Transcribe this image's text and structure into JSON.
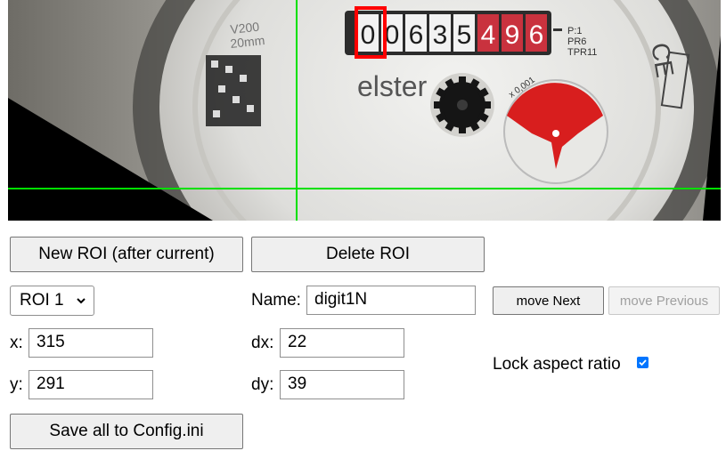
{
  "buttons": {
    "new_roi": "New ROI (after current)",
    "delete_roi": "Delete ROI",
    "move_next": "move Next",
    "move_previous": "move Previous",
    "save_all": "Save all to Config.ini"
  },
  "roi_select": {
    "selected": "ROI 1"
  },
  "fields": {
    "name_label": "Name:",
    "name_value": "digit1N",
    "x_label": "x:",
    "x_value": "315",
    "y_label": "y:",
    "y_value": "291",
    "dx_label": "dx:",
    "dx_value": "22",
    "dy_label": "dy:",
    "dy_value": "39"
  },
  "lock_aspect": {
    "label": "Lock aspect ratio",
    "checked": true
  },
  "meter_image": {
    "counter_digits": [
      "0",
      "0",
      "6",
      "3",
      "5",
      "4",
      "9",
      "6"
    ],
    "brand": "elster",
    "side_text": [
      "P:1",
      "PR6",
      "TPR11"
    ],
    "dial_text": "x 0,001",
    "left_text": [
      "V200",
      "20mm"
    ],
    "colors": {
      "guide_lines": "#00e000",
      "roi_box": "#ff0000",
      "dial_red": "#d81e1e"
    }
  }
}
